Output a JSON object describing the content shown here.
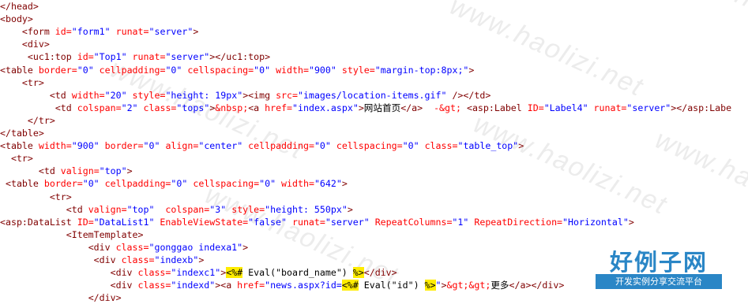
{
  "code_lines": [
    {
      "indent": "",
      "segments": [
        {
          "t": "</head>",
          "c": "tag"
        }
      ]
    },
    {
      "indent": "",
      "segments": [
        {
          "t": "<body>",
          "c": "tag"
        }
      ]
    },
    {
      "indent": "    ",
      "segments": [
        {
          "t": "<form",
          "c": "tag"
        },
        {
          "t": " id=",
          "c": "attr"
        },
        {
          "t": "\"form1\"",
          "c": "val"
        },
        {
          "t": " runat=",
          "c": "attr"
        },
        {
          "t": "\"server\"",
          "c": "val"
        },
        {
          "t": ">",
          "c": "tag"
        }
      ]
    },
    {
      "indent": "    ",
      "segments": [
        {
          "t": "<div>",
          "c": "tag"
        }
      ]
    },
    {
      "indent": "     ",
      "segments": [
        {
          "t": "<uc1:top",
          "c": "tag"
        },
        {
          "t": " id=",
          "c": "attr"
        },
        {
          "t": "\"Top1\"",
          "c": "val"
        },
        {
          "t": " runat=",
          "c": "attr"
        },
        {
          "t": "\"server\"",
          "c": "val"
        },
        {
          "t": "></uc1:top>",
          "c": "tag"
        }
      ]
    },
    {
      "indent": "",
      "segments": [
        {
          "t": "<table",
          "c": "tag"
        },
        {
          "t": " border=",
          "c": "attr"
        },
        {
          "t": "\"0\"",
          "c": "val"
        },
        {
          "t": " cellpadding=",
          "c": "attr"
        },
        {
          "t": "\"0\"",
          "c": "val"
        },
        {
          "t": " cellspacing=",
          "c": "attr"
        },
        {
          "t": "\"0\"",
          "c": "val"
        },
        {
          "t": " width=",
          "c": "attr"
        },
        {
          "t": "\"900\"",
          "c": "val"
        },
        {
          "t": " style=",
          "c": "attr"
        },
        {
          "t": "\"margin-top:8px;\"",
          "c": "val"
        },
        {
          "t": ">",
          "c": "tag"
        }
      ]
    },
    {
      "indent": "    ",
      "segments": [
        {
          "t": "<tr>",
          "c": "tag"
        }
      ]
    },
    {
      "indent": "         ",
      "segments": [
        {
          "t": "<td",
          "c": "tag"
        },
        {
          "t": " width=",
          "c": "attr"
        },
        {
          "t": "\"20\"",
          "c": "val"
        },
        {
          "t": " style=",
          "c": "attr"
        },
        {
          "t": "\"height: 19px\"",
          "c": "val"
        },
        {
          "t": "><img",
          "c": "tag"
        },
        {
          "t": " src=",
          "c": "attr"
        },
        {
          "t": "\"images/location-items.gif\"",
          "c": "val"
        },
        {
          "t": " /></td>",
          "c": "tag"
        }
      ]
    },
    {
      "indent": "          ",
      "segments": [
        {
          "t": "<td",
          "c": "tag"
        },
        {
          "t": " colspan=",
          "c": "attr"
        },
        {
          "t": "\"2\"",
          "c": "val"
        },
        {
          "t": " class=",
          "c": "attr"
        },
        {
          "t": "\"tops\"",
          "c": "val"
        },
        {
          "t": ">",
          "c": "tag"
        },
        {
          "t": "&nbsp;",
          "c": "attr"
        },
        {
          "t": "<a",
          "c": "tag"
        },
        {
          "t": " href=",
          "c": "attr"
        },
        {
          "t": "\"index.aspx\"",
          "c": "val"
        },
        {
          "t": ">",
          "c": "tag"
        },
        {
          "t": "网站首页",
          "c": "txt"
        },
        {
          "t": "</a>",
          "c": "tag"
        },
        {
          "t": "  ",
          "c": "txt"
        },
        {
          "t": "-&gt;",
          "c": "attr"
        },
        {
          "t": " ",
          "c": "txt"
        },
        {
          "t": "<asp:Label",
          "c": "tag"
        },
        {
          "t": " ID=",
          "c": "attr"
        },
        {
          "t": "\"Label4\"",
          "c": "val"
        },
        {
          "t": " runat=",
          "c": "attr"
        },
        {
          "t": "\"server\"",
          "c": "val"
        },
        {
          "t": "></asp:Labe",
          "c": "tag"
        }
      ]
    },
    {
      "indent": "     ",
      "segments": [
        {
          "t": "</tr>",
          "c": "tag"
        }
      ]
    },
    {
      "indent": "",
      "segments": [
        {
          "t": "</table>",
          "c": "tag"
        }
      ]
    },
    {
      "indent": "",
      "segments": [
        {
          "t": "<table",
          "c": "tag"
        },
        {
          "t": " width=",
          "c": "attr"
        },
        {
          "t": "\"900\"",
          "c": "val"
        },
        {
          "t": " border=",
          "c": "attr"
        },
        {
          "t": "\"0\"",
          "c": "val"
        },
        {
          "t": " align=",
          "c": "attr"
        },
        {
          "t": "\"center\"",
          "c": "val"
        },
        {
          "t": " cellpadding=",
          "c": "attr"
        },
        {
          "t": "\"0\"",
          "c": "val"
        },
        {
          "t": " cellspacing=",
          "c": "attr"
        },
        {
          "t": "\"0\"",
          "c": "val"
        },
        {
          "t": " class=",
          "c": "attr"
        },
        {
          "t": "\"table_top\"",
          "c": "val"
        },
        {
          "t": ">",
          "c": "tag"
        }
      ]
    },
    {
      "indent": "  ",
      "segments": [
        {
          "t": "<tr>",
          "c": "tag"
        }
      ]
    },
    {
      "indent": "       ",
      "segments": [
        {
          "t": "<td",
          "c": "tag"
        },
        {
          "t": " valign=",
          "c": "attr"
        },
        {
          "t": "\"top\"",
          "c": "val"
        },
        {
          "t": ">",
          "c": "tag"
        }
      ]
    },
    {
      "indent": " ",
      "segments": [
        {
          "t": "<table",
          "c": "tag"
        },
        {
          "t": " border=",
          "c": "attr"
        },
        {
          "t": "\"0\"",
          "c": "val"
        },
        {
          "t": " cellpadding=",
          "c": "attr"
        },
        {
          "t": "\"0\"",
          "c": "val"
        },
        {
          "t": " cellspacing=",
          "c": "attr"
        },
        {
          "t": "\"0\"",
          "c": "val"
        },
        {
          "t": " width=",
          "c": "attr"
        },
        {
          "t": "\"642\"",
          "c": "val"
        },
        {
          "t": ">",
          "c": "tag"
        }
      ]
    },
    {
      "indent": "         ",
      "segments": [
        {
          "t": "<tr>",
          "c": "tag"
        }
      ]
    },
    {
      "indent": "            ",
      "segments": [
        {
          "t": "<td",
          "c": "tag"
        },
        {
          "t": " valign=",
          "c": "attr"
        },
        {
          "t": "\"top\"",
          "c": "val"
        },
        {
          "t": "  colspan=",
          "c": "attr"
        },
        {
          "t": "\"3\"",
          "c": "val"
        },
        {
          "t": " style=",
          "c": "attr"
        },
        {
          "t": "\"height: 550px\"",
          "c": "val"
        },
        {
          "t": ">",
          "c": "tag"
        }
      ]
    },
    {
      "indent": "",
      "segments": [
        {
          "t": "<asp:DataList",
          "c": "tag"
        },
        {
          "t": " ID=",
          "c": "attr"
        },
        {
          "t": "\"DataList1\"",
          "c": "val"
        },
        {
          "t": " EnableViewState=",
          "c": "attr"
        },
        {
          "t": "\"false\"",
          "c": "val"
        },
        {
          "t": " runat=",
          "c": "attr"
        },
        {
          "t": "\"server\"",
          "c": "val"
        },
        {
          "t": " RepeatColumns=",
          "c": "attr"
        },
        {
          "t": "\"1\"",
          "c": "val"
        },
        {
          "t": " RepeatDirection=",
          "c": "attr"
        },
        {
          "t": "\"Horizontal\"",
          "c": "val"
        },
        {
          "t": ">",
          "c": "tag"
        }
      ]
    },
    {
      "indent": "            ",
      "segments": [
        {
          "t": "<ItemTemplate>",
          "c": "tag"
        }
      ]
    },
    {
      "indent": "                ",
      "segments": [
        {
          "t": "<div",
          "c": "tag"
        },
        {
          "t": " class=",
          "c": "attr"
        },
        {
          "t": "\"gonggao indexa1\"",
          "c": "val"
        },
        {
          "t": ">",
          "c": "tag"
        }
      ]
    },
    {
      "indent": "                 ",
      "segments": [
        {
          "t": "<div",
          "c": "tag"
        },
        {
          "t": " class=",
          "c": "attr"
        },
        {
          "t": "\"indexb\"",
          "c": "val"
        },
        {
          "t": ">",
          "c": "tag"
        }
      ]
    },
    {
      "indent": "                    ",
      "segments": [
        {
          "t": "<div",
          "c": "tag"
        },
        {
          "t": " class=",
          "c": "attr"
        },
        {
          "t": "\"indexc1\"",
          "c": "val"
        },
        {
          "t": ">",
          "c": "tag"
        },
        {
          "t": "<%#",
          "c": "hl"
        },
        {
          "t": " Eval(\"board_name\") ",
          "c": "txt"
        },
        {
          "t": "%>",
          "c": "hl"
        },
        {
          "t": "</div>",
          "c": "tag"
        }
      ]
    },
    {
      "indent": "                    ",
      "segments": [
        {
          "t": "<div",
          "c": "tag"
        },
        {
          "t": " class=",
          "c": "attr"
        },
        {
          "t": "\"indexd\"",
          "c": "val"
        },
        {
          "t": "><a",
          "c": "tag"
        },
        {
          "t": " href=",
          "c": "attr"
        },
        {
          "t": "\"news.aspx?id=",
          "c": "val"
        },
        {
          "t": "<%#",
          "c": "hl"
        },
        {
          "t": " Eval(\"id\") ",
          "c": "txt"
        },
        {
          "t": "%>",
          "c": "hl"
        },
        {
          "t": "\"",
          "c": "val"
        },
        {
          "t": ">",
          "c": "tag"
        },
        {
          "t": "&gt;&gt;",
          "c": "attr"
        },
        {
          "t": "更多",
          "c": "txt"
        },
        {
          "t": "</a></div>",
          "c": "tag"
        }
      ]
    },
    {
      "indent": "                ",
      "segments": [
        {
          "t": "</div>",
          "c": "tag"
        }
      ]
    }
  ],
  "watermark": {
    "text": "www.haolizi.net",
    "color": "#ececec"
  },
  "brand": {
    "name": "好例子网",
    "tagline": "开发实例分享交流平台",
    "color": "#2a86c6"
  },
  "colors": {
    "tag": "#800000",
    "attribute": "#ff0000",
    "value": "#0000ff",
    "highlight": "#ffec00"
  }
}
